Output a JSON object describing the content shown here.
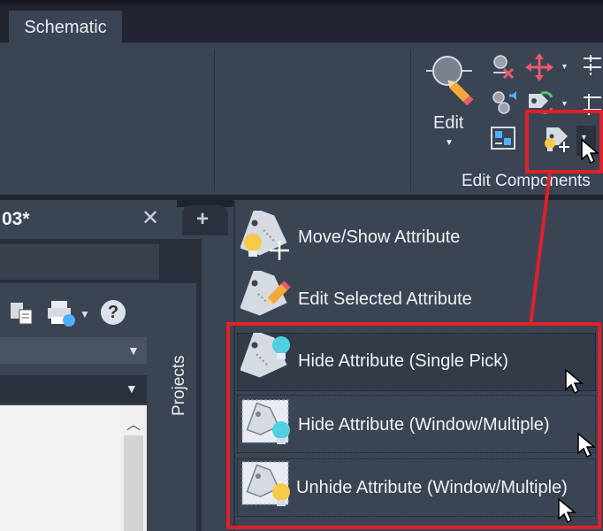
{
  "ribbon": {
    "tab_label": "Schematic",
    "edit_label": "Edit",
    "panel_title": "Edit Components"
  },
  "document": {
    "tab_label": "03*",
    "close_glyph": "✕",
    "new_tab_glyph": "+"
  },
  "sidebar": {
    "projects_label": "Projects",
    "help_glyph": "?"
  },
  "menu": {
    "items": [
      {
        "label": "Move/Show Attribute",
        "icon": "move-attribute-icon"
      },
      {
        "label": "Edit Selected Attribute",
        "icon": "edit-attribute-icon"
      },
      {
        "label": "Hide Attribute (Single Pick)",
        "icon": "hide-attribute-single-icon"
      },
      {
        "label": "Hide Attribute (Window/Multiple)",
        "icon": "hide-attribute-window-icon"
      },
      {
        "label": "Unhide Attribute (Window/Multiple)",
        "icon": "unhide-attribute-window-icon"
      }
    ]
  },
  "colors": {
    "highlight": "#e0202a",
    "background": "#3b4453",
    "topbar": "#1f2430",
    "bulb_yellow": "#f7c948",
    "bulb_cyan": "#4fd1e0"
  }
}
